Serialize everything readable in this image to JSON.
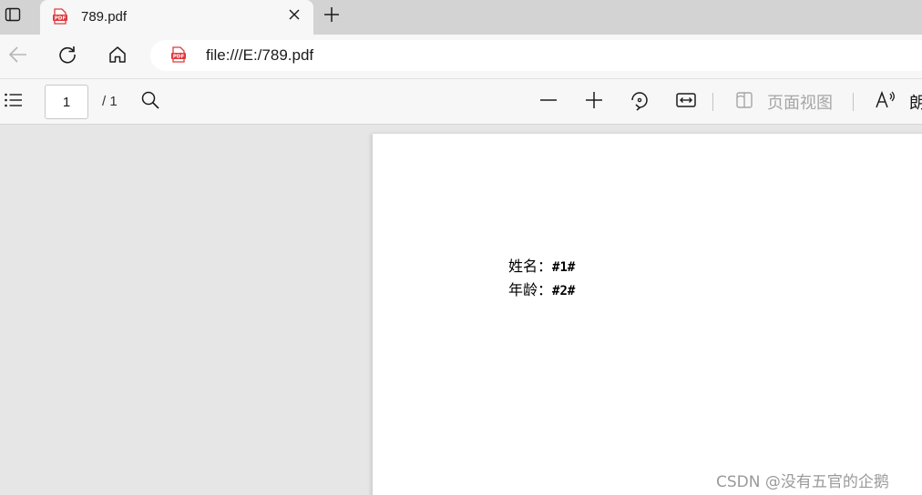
{
  "browser": {
    "tab": {
      "title": "789.pdf",
      "favicon_icon": "pdf-file-icon"
    },
    "address": {
      "url": "file:///E:/789.pdf"
    }
  },
  "pdf_toolbar": {
    "page_number": "1",
    "page_total": "/ 1",
    "page_view_label": "页面视图",
    "read_aloud_label": "朗"
  },
  "document": {
    "fields": [
      {
        "label": "姓名：",
        "value": "#1#"
      },
      {
        "label": "年龄：",
        "value": "#2#"
      }
    ]
  },
  "watermark": "CSDN @没有五官的企鹅",
  "colors": {
    "pdf_red": "#e0393e",
    "tabstrip": "#d3d3d3",
    "chrome": "#f7f7f7",
    "viewer_bg": "#e6e6e6",
    "disabled_text": "#a6a6a6"
  }
}
